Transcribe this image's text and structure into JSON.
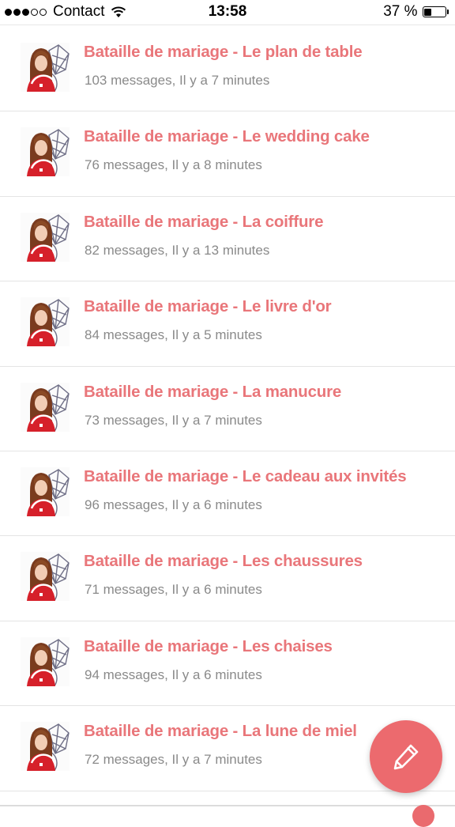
{
  "status_bar": {
    "carrier": "Contact",
    "time": "13:58",
    "battery": "37 %",
    "battery_level": 0.37,
    "signal_bars_filled": 3,
    "signal_bars_total": 5
  },
  "threads": [
    {
      "title": "Bataille de mariage - Le plan de table",
      "meta": "103 messages, Il y a 7 minutes"
    },
    {
      "title": "Bataille de mariage - Le wedding cake",
      "meta": "76 messages, Il y a 8 minutes"
    },
    {
      "title": "Bataille de mariage - La coiffure",
      "meta": "82 messages, Il y a 13 minutes"
    },
    {
      "title": "Bataille de mariage - Le livre d'or",
      "meta": "84 messages, Il y a 5 minutes"
    },
    {
      "title": "Bataille de mariage - La manucure",
      "meta": "73 messages, Il y a 7 minutes"
    },
    {
      "title": "Bataille de mariage - Le cadeau aux invités",
      "meta": "96 messages, Il y a 6 minutes"
    },
    {
      "title": "Bataille de mariage - Les chaussures",
      "meta": "71 messages, Il y a 6 minutes"
    },
    {
      "title": "Bataille de mariage - Les chaises",
      "meta": "94 messages, Il y a 6 minutes"
    },
    {
      "title": "Bataille de mariage - La lune de miel",
      "meta": "72 messages, Il y a 7 minutes"
    }
  ],
  "fab": {
    "icon": "pencil-icon"
  },
  "colors": {
    "accent": "#e9767a",
    "fab": "#ec6a6e",
    "meta_text": "#8a8a8a",
    "divider": "#e4e4e4"
  }
}
